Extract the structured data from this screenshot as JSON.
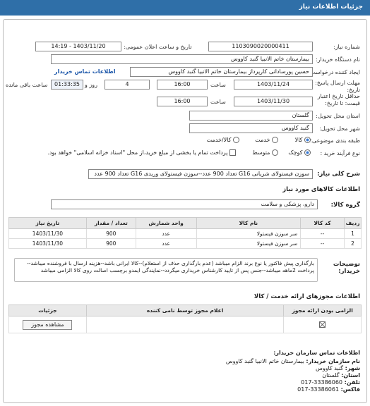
{
  "header": {
    "title": "جزئیات اطلاعات نیاز"
  },
  "form": {
    "need_number_label": "شماره نیاز:",
    "need_number": "1103090020000411",
    "announce_label": "تاریخ و ساعت اعلان عمومی:",
    "announce_value": "1403/11/20 - 14:19",
    "buyer_label": "نام دستگاه خریدار:",
    "buyer_value": "بیمارستان خاتم الانبیا گنبد کاووس",
    "creator_label": "ایجاد کننده درخواست:",
    "creator_value": "حسین پورسادانی کارپرداز بیمارستان خاتم الانبیا گنبد کاووس",
    "contact_link": "اطلاعات تماس خریدار",
    "deadline_label": "مهلت ارسال پاسخ: تا",
    "deadline_label2": "تاریخ:",
    "deadline_date": "1403/11/24",
    "time_label": "ساعت",
    "deadline_time": "16:00",
    "days_value": "4",
    "days_label": "روز و",
    "remaining_time": "01:33:35",
    "remaining_label": "ساعت باقی مانده",
    "validity_label1": "حداقل تاریخ اعتبار",
    "validity_label2": "قیمت: تا تاریخ:",
    "validity_date": "1403/11/30",
    "validity_time": "16:00",
    "province_label": "استان محل تحویل:",
    "province_value": "گلستان",
    "city_label": "شهر محل تحویل:",
    "city_value": "گنبد کاووس",
    "category_label": "طبقه بندی موضوعی:",
    "category_options": [
      "کالا",
      "خدمت",
      "کالا/خدمت"
    ],
    "process_label": "نوع فرآیند خرید :",
    "process_options": [
      "کوچک",
      "متوسط"
    ],
    "payment_note": "پرداخت تمام یا بخشی از مبلغ خرید،از محل \"اسناد خزانه اسلامی\" خواهد بود."
  },
  "summary": {
    "label": "شرح کلی نیاز:",
    "text": "سوزن فیستولای شریانی G16 تعداد 900 عدد--سوزن فیستولای وریدی G16 تعداد 900 عدد"
  },
  "goods": {
    "section_title": "اطلاعات کالاهای مورد نیاز",
    "group_label": "گروه کالا:",
    "group_value": "دارو، پزشکی و سلامت",
    "columns": [
      "ردیف",
      "کد کالا",
      "نام کالا",
      "واحد شمارش",
      "تعداد / مقدار",
      "تاریخ نیاز"
    ],
    "rows": [
      {
        "idx": "1",
        "code": "--",
        "name": "سر سوزن فیستولا",
        "unit": "عدد",
        "qty": "900",
        "date": "1403/11/30"
      },
      {
        "idx": "2",
        "code": "--",
        "name": "سر سوزن فیستولا",
        "unit": "عدد",
        "qty": "900",
        "date": "1403/11/30"
      }
    ]
  },
  "buyer_notes": {
    "label": "توضیحات خریدار:",
    "text": "بارگذاری پیش فاکتور یا نوع برند الزام میباشد (عدم بارگذاری حذف از استعلام)--کالا ایرانی باشد--هزینه ارسال با فروشنده میباشد--پرداخت 2ماهه میباشد--جنس پس از تایید کارشناس خریداری میگردد--نمایندگی ایمدو برچسب اصالت روی کالا الزامی میباشد"
  },
  "permits": {
    "section_title": "اطلاعات مجوزهای ارائه خدمت / کالا",
    "columns": [
      "الزامی بودن ارائه مجوز",
      "اعلام مجوز توسط نامی کننده",
      "جزئیات"
    ],
    "row_button": "مشاهده مجوز"
  },
  "contact": {
    "section_title": "اطلاعات تماس سازمان خریدار:",
    "org_label": "نام سازمان خریدار:",
    "org_value": "بیمارستان خاتم الانبیا گنبد کاووس",
    "city_label": "شهر:",
    "city_value": "گنبد کاووس",
    "province_label": "استان:",
    "province_value": "گلستان",
    "phone_label": "تلفن:",
    "phone_value": "017-33386060",
    "fax_label": "فاکس:",
    "fax_value": "017-33386061"
  }
}
